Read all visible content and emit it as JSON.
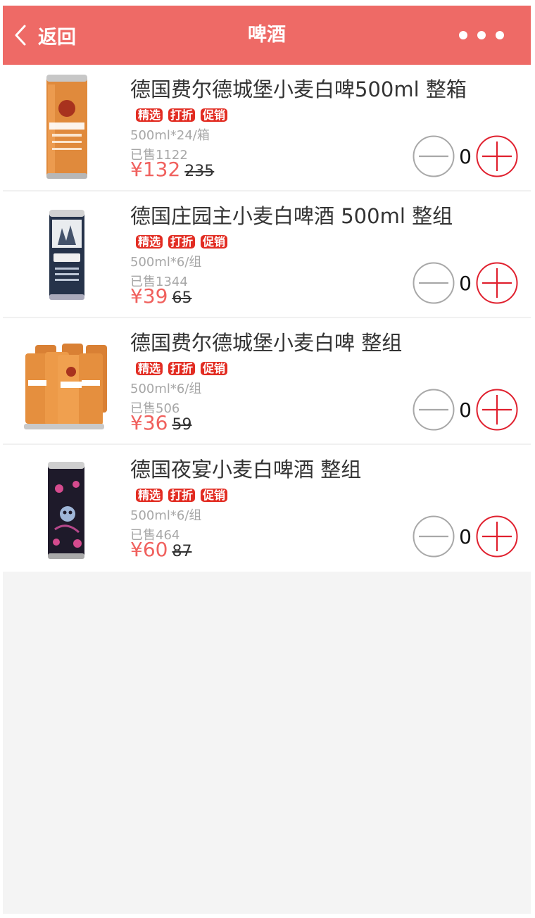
{
  "header": {
    "back_label": "返回",
    "title": "啤酒",
    "bg_color": "#ee6a66"
  },
  "products": [
    {
      "name": "德国费尔德城堡小麦白啤500ml 整箱",
      "tags": [
        "精选",
        "打折",
        "促销"
      ],
      "spec": "500ml*24/箱",
      "sold": "已售1122",
      "currency": "¥",
      "price": "132",
      "original_price": "235",
      "quantity": "0",
      "image": "orange-beer-can"
    },
    {
      "name": "德国庄园主小麦白啤酒 500ml 整组",
      "tags": [
        "精选",
        "打折",
        "促销"
      ],
      "spec": "500ml*6/组",
      "sold": "已售1344",
      "currency": "¥",
      "price": "39",
      "original_price": "65",
      "quantity": "0",
      "image": "white-navy-beer-can"
    },
    {
      "name": "德国费尔德城堡小麦白啤 整组",
      "tags": [
        "精选",
        "打折",
        "促销"
      ],
      "spec": "500ml*6/组",
      "sold": "已售506",
      "currency": "¥",
      "price": "36",
      "original_price": "59",
      "quantity": "0",
      "image": "orange-beer-six-pack"
    },
    {
      "name": "德国夜宴小麦白啤酒 整组",
      "tags": [
        "精选",
        "打折",
        "促销"
      ],
      "spec": "500ml*6/组",
      "sold": "已售464",
      "currency": "¥",
      "price": "60",
      "original_price": "87",
      "quantity": "0",
      "image": "black-skull-beer-can"
    }
  ],
  "colors": {
    "accent": "#f0615e",
    "tag": "#e22c22",
    "muted": "#a7a7a7"
  }
}
